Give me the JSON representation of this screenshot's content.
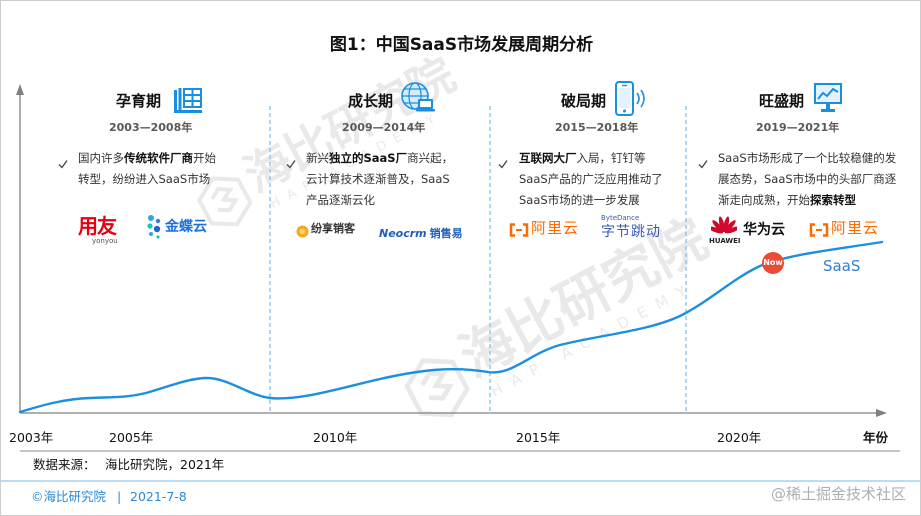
{
  "title": "图1：中国SaaS市场发展周期分析",
  "axis": {
    "ticks": [
      "2003年",
      "2005年",
      "2010年",
      "2015年",
      "2020年"
    ],
    "x_label": "年份"
  },
  "bullet_icon": "check-icon",
  "phases": [
    {
      "name": "孕育期",
      "icon": "building-icon",
      "period": "2003—2008年",
      "lines": [
        {
          "pre": "国内许多",
          "bold": "传统软件厂商",
          "post": "开始"
        },
        {
          "pre": "转型，纷纷进入SaaS市场"
        }
      ],
      "logos": [
        {
          "name": "用友",
          "sub": "yonyou",
          "color": "#e60012"
        },
        {
          "name": "金蝶云",
          "icon": "kingdee-dots-icon",
          "color": "#1d6fe0"
        }
      ]
    },
    {
      "name": "成长期",
      "icon": "globe-laptop-icon",
      "period": "2009—2014年",
      "lines": [
        {
          "pre": "新兴",
          "bold": "独立的SaaS厂",
          "post": "商兴起，"
        },
        {
          "pre": "云计算技术逐渐普及，SaaS"
        },
        {
          "pre": "产品逐渐云化"
        }
      ],
      "logos": [
        {
          "name": "纷享销客",
          "icon": "fxiaoke-icon",
          "color": "#333333"
        },
        {
          "prefix": "Neocrm",
          "name": "销售易",
          "color": "#1f5eb8"
        }
      ]
    },
    {
      "name": "破局期",
      "icon": "smartphone-icon",
      "period": "2015—2018年",
      "lines": [
        {
          "bold": "互联网大厂",
          "post": "入局，钉钉等"
        },
        {
          "pre": "SaaS产品的广泛应用推动了"
        },
        {
          "pre": "SaaS市场的进一步发展"
        }
      ],
      "logos": [
        {
          "name": "阿里云",
          "icon": "aliyun-bracket-icon",
          "color": "#ff6a00"
        },
        {
          "prefix": "ByteDance",
          "name": "字节跳动",
          "color": "#3c5bb0"
        }
      ]
    },
    {
      "name": "旺盛期",
      "icon": "monitor-chart-icon",
      "period": "2019—2021年",
      "lines": [
        {
          "pre": "SaaS市场形成了一个比较稳健的发"
        },
        {
          "pre": "展态势，SaaS市场中的头部厂商逐"
        },
        {
          "pre": "渐走向成熟，开始",
          "bold": "探索转型"
        }
      ],
      "logos": [
        {
          "name": "华为云",
          "sub": "HUAWEI",
          "icon": "huawei-flower-icon",
          "icon_color": "#cf0a2c"
        },
        {
          "name": "阿里云",
          "icon": "aliyun-bracket-icon",
          "color": "#ff6a00"
        },
        {
          "name": "Now",
          "color": "#e94b35"
        },
        {
          "name": "SaaS",
          "color": "#2f7fd6"
        }
      ]
    }
  ],
  "source": {
    "label": "数据来源：",
    "value": "海比研究院，2021年"
  },
  "footer": {
    "org": "©海比研究院",
    "sep": "|",
    "date": "2021-7-8"
  },
  "corner_watermark": "@稀土掘金技术社区",
  "background_watermark": {
    "name": "海比研究院",
    "sub": "HAP ACADEMY",
    "icon": "hap-logo-icon"
  },
  "colors": {
    "accent_curve": "#1c8fe0",
    "divider": "#7ec2ea",
    "footer": "#2c8ad6",
    "period_text": "#595959",
    "axis": "#808080"
  }
}
